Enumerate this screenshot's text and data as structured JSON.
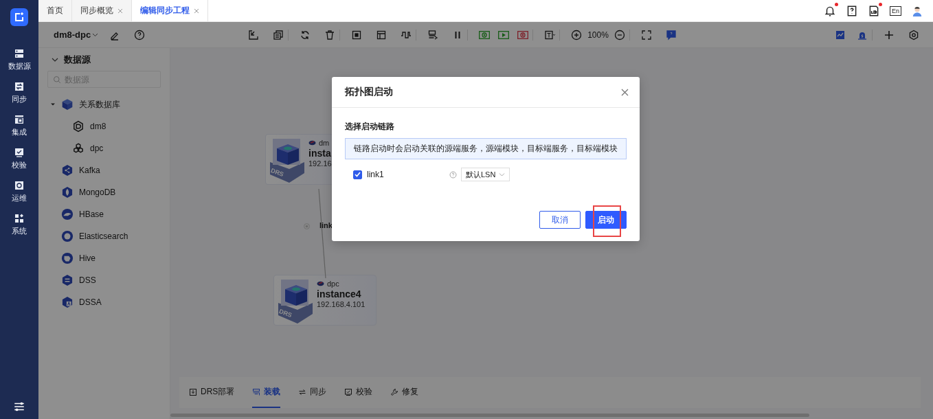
{
  "nav": {
    "items": [
      {
        "label": "数据源",
        "kind": "datasource"
      },
      {
        "label": "同步",
        "kind": "sync"
      },
      {
        "label": "集成",
        "kind": "integrate"
      },
      {
        "label": "校验",
        "kind": "verify"
      },
      {
        "label": "运维",
        "kind": "ops"
      },
      {
        "label": "系统",
        "kind": "system"
      }
    ]
  },
  "tabs": [
    {
      "label": "首页",
      "selected": false,
      "closable": false
    },
    {
      "label": "同步概览",
      "selected": false,
      "closable": true
    },
    {
      "label": "编辑同步工程",
      "selected": true,
      "closable": true
    }
  ],
  "header_icons": [
    {
      "kind": "bell",
      "badge": true
    },
    {
      "kind": "help",
      "badge": false
    },
    {
      "kind": "log",
      "badge": true
    },
    {
      "kind": "language",
      "label": "En",
      "badge": false
    },
    {
      "kind": "avatar",
      "badge": false
    }
  ],
  "toolbar": {
    "project": "dm8-dpc",
    "zoom": "100%"
  },
  "datasource_panel": {
    "title": "数据源",
    "search_placeholder": "数据源",
    "tree": [
      {
        "label": "关系数据库",
        "kind": "relational",
        "expanded": true,
        "children": [
          {
            "label": "dm8",
            "kind": "dm"
          },
          {
            "label": "dpc",
            "kind": "dpc"
          }
        ]
      },
      {
        "label": "Kafka",
        "kind": "kafka"
      },
      {
        "label": "MongoDB",
        "kind": "mongo"
      },
      {
        "label": "HBase",
        "kind": "hbase"
      },
      {
        "label": "Elasticsearch",
        "kind": "es"
      },
      {
        "label": "Hive",
        "kind": "hive"
      },
      {
        "label": "DSS",
        "kind": "dss"
      },
      {
        "label": "DSSA",
        "kind": "dssa"
      }
    ]
  },
  "canvas": {
    "nodes": [
      {
        "db": "dm",
        "name": "insta",
        "ip": "192.16",
        "badge": "DRS"
      },
      {
        "db": "dpc",
        "name": "instance4",
        "ip": "192.168.4.101",
        "badge": "DRS"
      }
    ],
    "link_label": "link"
  },
  "bottom_tabs": [
    {
      "label": "DRS部署",
      "kind": "deploy",
      "selected": false
    },
    {
      "label": "装载",
      "kind": "load",
      "selected": true
    },
    {
      "label": "同步",
      "kind": "sync",
      "selected": false
    },
    {
      "label": "校验",
      "kind": "verify",
      "selected": false
    },
    {
      "label": "修复",
      "kind": "repair",
      "selected": false
    }
  ],
  "dialog": {
    "title": "拓扑图启动",
    "section": "选择启动链路",
    "notice": "链路启动时会启动关联的源端服务，源端模块，目标端服务，目标端模块",
    "links": [
      {
        "label": "link1",
        "checked": true,
        "position": "默认LSN"
      }
    ],
    "buttons": [
      {
        "label": "取消",
        "kind": "secondary"
      },
      {
        "label": "启动",
        "kind": "primary"
      }
    ]
  }
}
